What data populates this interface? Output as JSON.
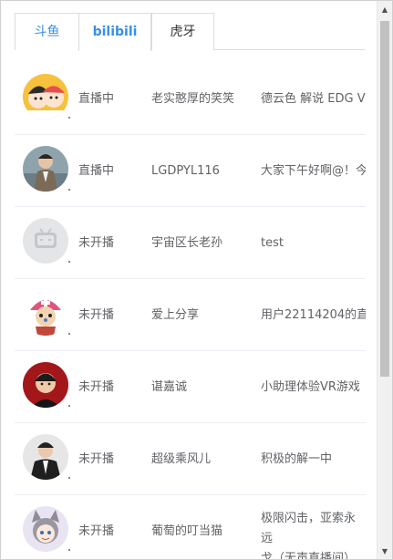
{
  "tabs": [
    {
      "label": "斗鱼",
      "active": false
    },
    {
      "label": "bilibili",
      "active": true
    },
    {
      "label": "虎牙",
      "active": false
    }
  ],
  "streamers": [
    {
      "status": "直播中",
      "name": "老实憨厚的笑笑",
      "title": "德云色 解说 EDG VS",
      "avatar": "cartoon-duo-avatar"
    },
    {
      "status": "直播中",
      "name": "LGDPYL116",
      "title": "大家下午好啊@！今",
      "avatar": "man-in-suit-avatar"
    },
    {
      "status": "未开播",
      "name": "宇宙区长老孙",
      "title": "test",
      "avatar": "bilibili-default-tv-avatar"
    },
    {
      "status": "未开播",
      "name": "爱上分享",
      "title": "用户22114204的直",
      "avatar": "chopper-avatar"
    },
    {
      "status": "未开播",
      "name": "谌嘉诚",
      "title": "小助理体验VR游戏",
      "avatar": "cartoon-man-red-avatar"
    },
    {
      "status": "未开播",
      "name": "超级乘风儿",
      "title": "积极的解一中",
      "avatar": "man-dark-jacket-avatar"
    },
    {
      "status": "未开播",
      "name": "葡萄的叮当猫",
      "title": "极限闪击，亚索永远\n戈（无声直播间）",
      "avatar": "anime-cat-girl-avatar"
    }
  ],
  "scrollbar": {
    "up_icon": "▲",
    "down_icon": "▼"
  },
  "colors": {
    "accent": "#3a8ee6",
    "text": "#606266",
    "divider": "#ebeef5"
  }
}
